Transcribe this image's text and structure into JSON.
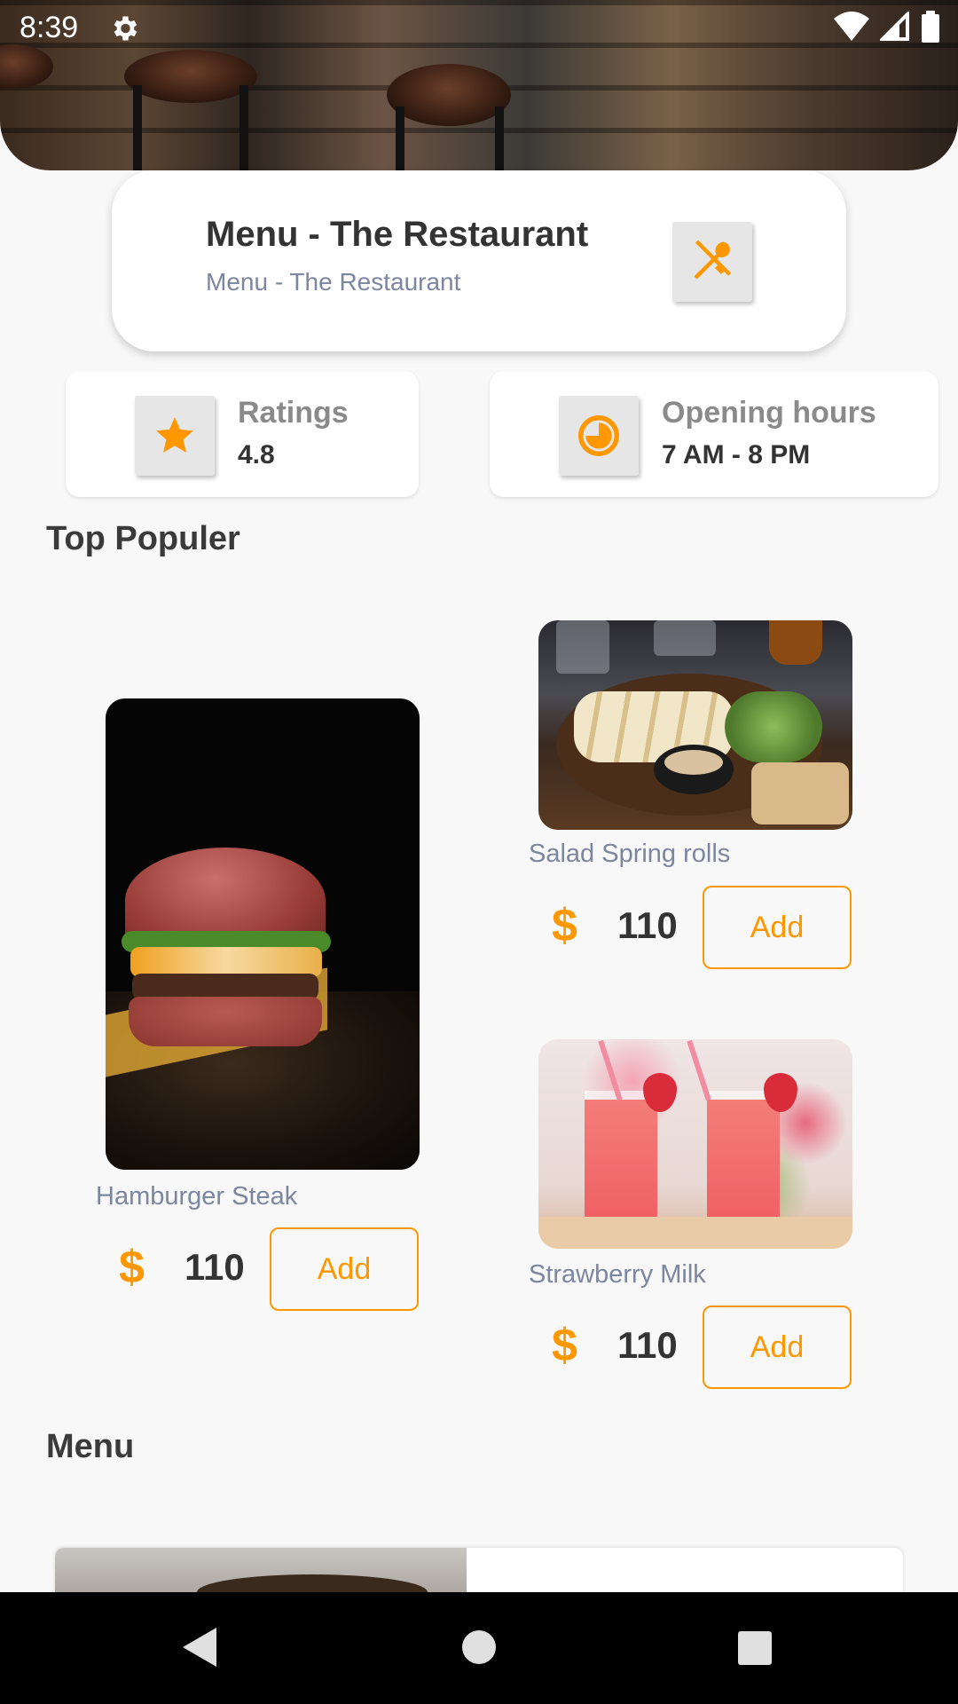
{
  "status_bar": {
    "time": "8:39"
  },
  "header": {
    "title": "Menu - The Restaurant",
    "subtitle": "Menu - The Restaurant"
  },
  "info": {
    "ratings": {
      "label": "Ratings",
      "value": "4.8"
    },
    "hours": {
      "label": "Opening hours",
      "value": "7 AM - 8 PM"
    }
  },
  "sections": {
    "top_popular": "Top Populer",
    "menu": "Menu"
  },
  "popular_items": [
    {
      "name": "Hamburger Steak",
      "currency": "$",
      "price": "110",
      "add_label": "Add"
    },
    {
      "name": "Salad Spring rolls",
      "currency": "$",
      "price": "110",
      "add_label": "Add"
    },
    {
      "name": "Strawberry Milk",
      "currency": "$",
      "price": "110",
      "add_label": "Add"
    }
  ],
  "colors": {
    "accent": "#ff9800",
    "subtitle": "#7d86a0",
    "background": "#f8f8f8"
  },
  "icons": {
    "settings": "gear-icon",
    "wifi": "wifi-icon",
    "signal": "signal-icon",
    "battery": "battery-icon",
    "restaurant": "fork-spoon-icon",
    "rating": "star-icon",
    "hours": "clock-icon",
    "nav_back": "back-triangle-icon",
    "nav_home": "home-circle-icon",
    "nav_recents": "recents-square-icon"
  }
}
